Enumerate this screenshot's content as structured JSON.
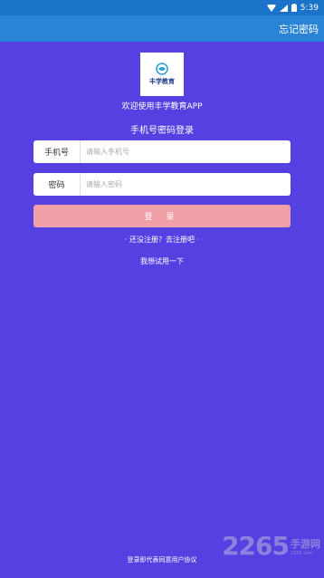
{
  "status_bar": {
    "time": "5:39"
  },
  "app_bar": {
    "forgot_password": "忘记密码"
  },
  "logo": {
    "text": "丰学教育"
  },
  "welcome_text": "欢迎使用丰学教育APP",
  "login_title": "手机号密码登录",
  "phone_field": {
    "label": "手机号",
    "placeholder": "请输入手机号",
    "value": ""
  },
  "password_field": {
    "label": "密码",
    "placeholder": "请输入密码",
    "value": ""
  },
  "login_button": "登 录",
  "register_link": "· 还没注册？去注册吧 ·",
  "trial_link": "我想试用一下",
  "agreement_text": "登录即代表同意用户协议",
  "watermark": {
    "number": "2265",
    "site_cn": "手游网",
    "site_url": "2265.com"
  },
  "colors": {
    "background": "#5540e2",
    "app_bar": "#2a84d6",
    "status_bar": "#1a72c9",
    "login_button": "#f2a0a8"
  },
  "icons": [
    "wifi-icon",
    "signal-icon",
    "battery-icon"
  ]
}
